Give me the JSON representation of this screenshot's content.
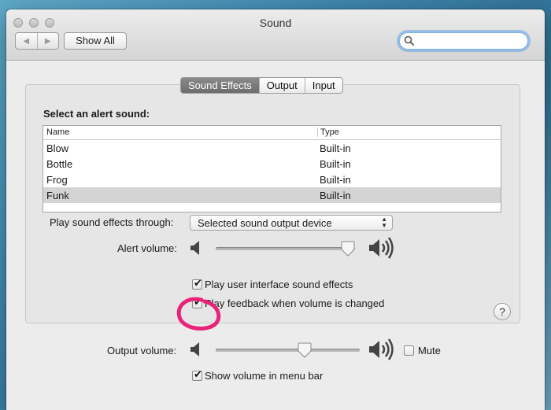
{
  "window": {
    "title": "Sound"
  },
  "toolbar": {
    "show_all_label": "Show All",
    "search_value": ""
  },
  "tabs": [
    {
      "label": "Sound Effects",
      "active": true
    },
    {
      "label": "Output",
      "active": false
    },
    {
      "label": "Input",
      "active": false
    }
  ],
  "sound_effects": {
    "heading": "Select an alert sound:",
    "columns": {
      "name": "Name",
      "type": "Type"
    },
    "rows": [
      {
        "name": "Blow",
        "type": "Built-in"
      },
      {
        "name": "Bottle",
        "type": "Built-in"
      },
      {
        "name": "Frog",
        "type": "Built-in"
      },
      {
        "name": "Funk",
        "type": "Built-in",
        "selected": true
      }
    ],
    "play_through_label": "Play sound effects through:",
    "play_through_value": "Selected sound output device",
    "alert_volume_label": "Alert volume:",
    "alert_volume_level": 0.95,
    "ui_sounds_label": "Play user interface sound effects",
    "ui_sounds_checked": true,
    "feedback_label": "Play feedback when volume is changed",
    "feedback_checked": true,
    "help_label": "?"
  },
  "output_volume": {
    "label": "Output volume:",
    "level": 0.62,
    "mute_label": "Mute",
    "mute_checked": false,
    "menu_bar_label": "Show volume in menu bar",
    "menu_bar_checked": true
  },
  "colors": {
    "annotation": "#e8237a",
    "active_tab": "#7a7a7a",
    "focus_ring": "#5fa0e6"
  }
}
